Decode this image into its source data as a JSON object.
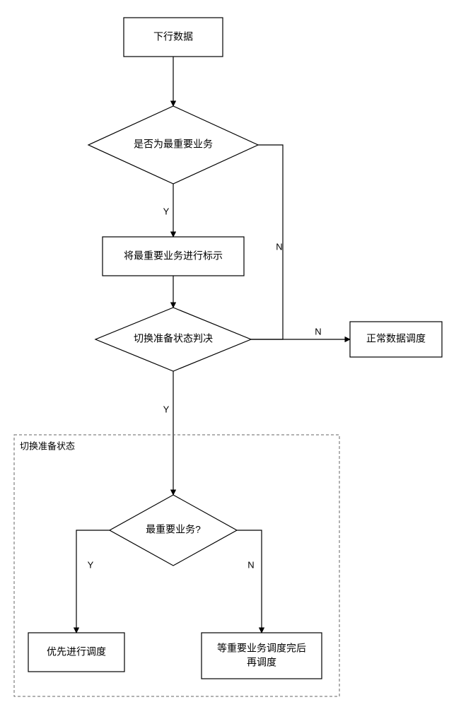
{
  "nodes": {
    "start": "下行数据",
    "decision1": "是否为最重要业务",
    "mark": "将最重要业务进行标示",
    "decision2": "切换准备状态判决",
    "normal": "正常数据调度",
    "groupLabel": "切换准备状态",
    "decision3": "最重要业务?",
    "priority": "优先进行调度",
    "waitLine1": "等重要业务调度完后",
    "waitLine2": "再调度"
  },
  "labels": {
    "yes": "Y",
    "no": "N"
  }
}
